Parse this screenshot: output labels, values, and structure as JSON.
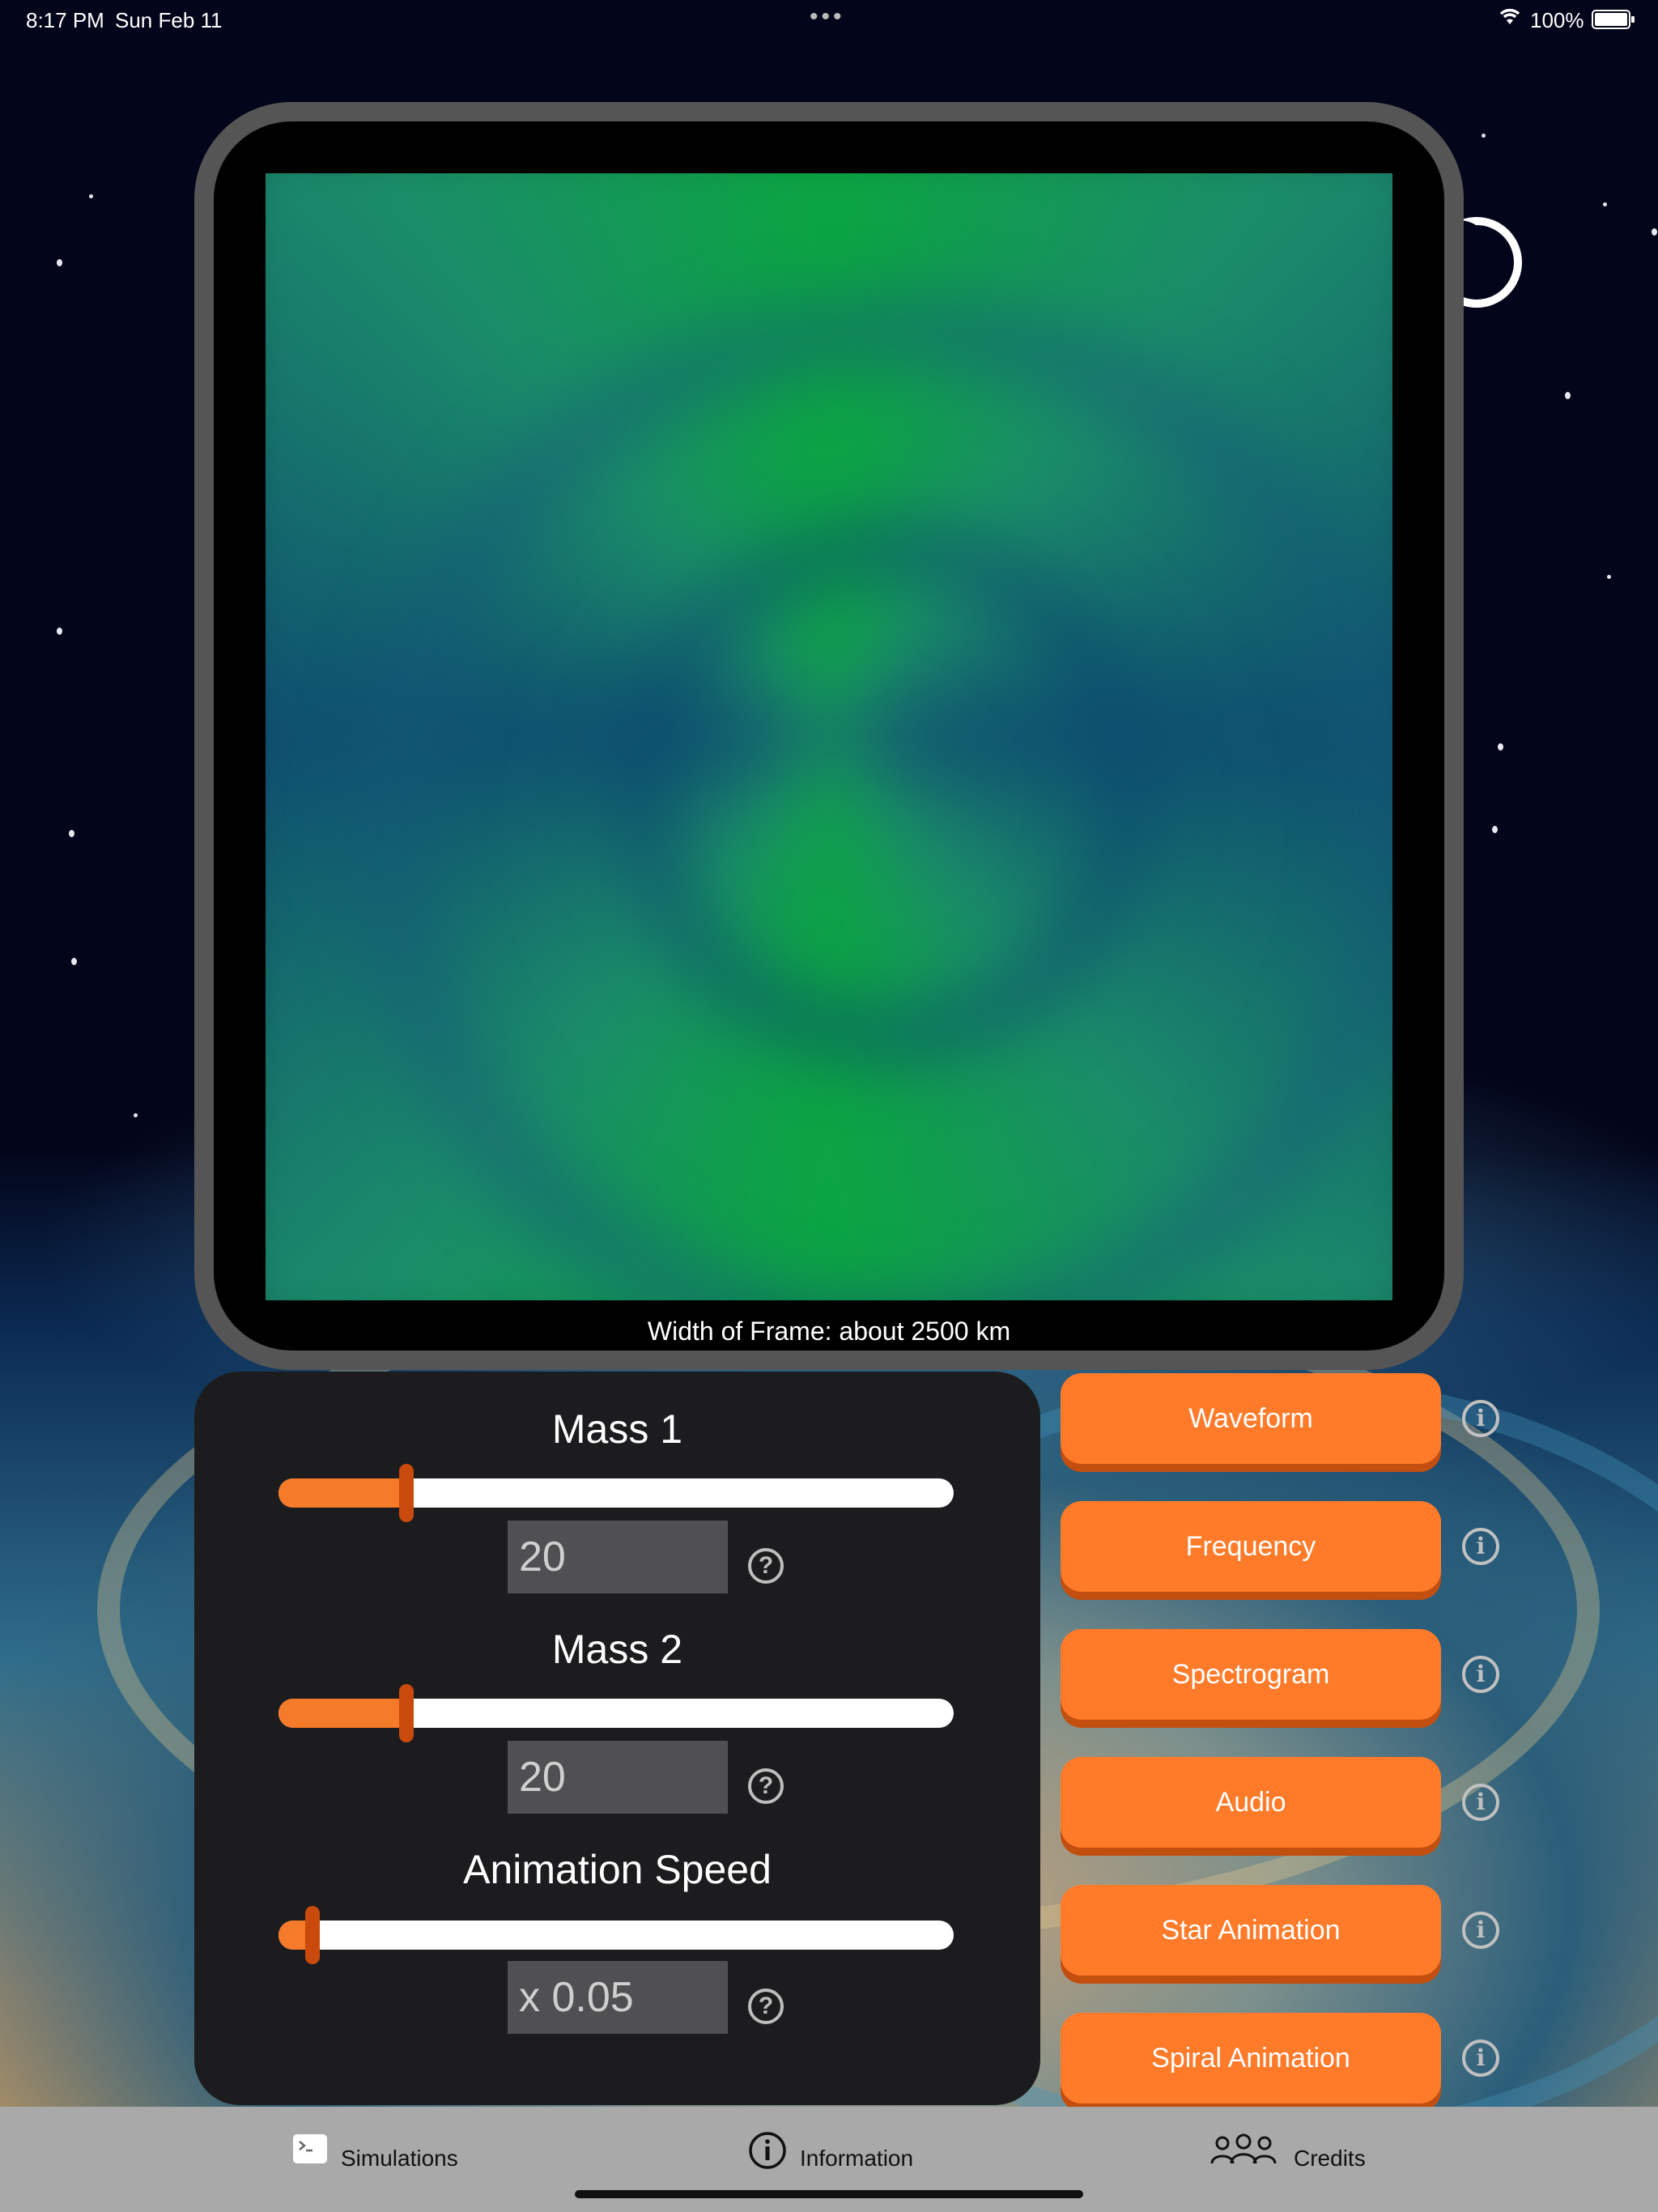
{
  "status_bar": {
    "time": "8:17 PM",
    "date": "Sun Feb 11",
    "battery": "100%"
  },
  "simulation": {
    "caption": "Width of Frame: about 2500 km"
  },
  "controls": [
    {
      "title": "Mass 1",
      "value": "20",
      "level": 0.19
    },
    {
      "title": "Mass 2",
      "value": "20",
      "level": 0.19
    },
    {
      "title": "Animation Speed",
      "value": "x 0.05",
      "level": 0.05
    }
  ],
  "buttons": [
    "Waveform",
    "Frequency",
    "Spectrogram",
    "Audio",
    "Star Animation",
    "Spiral Animation"
  ],
  "tabs": [
    {
      "label": "Simulations",
      "icon": "terminal-icon"
    },
    {
      "label": "Information",
      "icon": "info-circle-icon"
    },
    {
      "label": "Credits",
      "icon": "people-icon"
    }
  ],
  "colors": {
    "accent": "#ff7a29",
    "slider_thumb": "#c94a0c",
    "panel": "#1c1c1e",
    "tabbar": "#a9a9a9"
  }
}
